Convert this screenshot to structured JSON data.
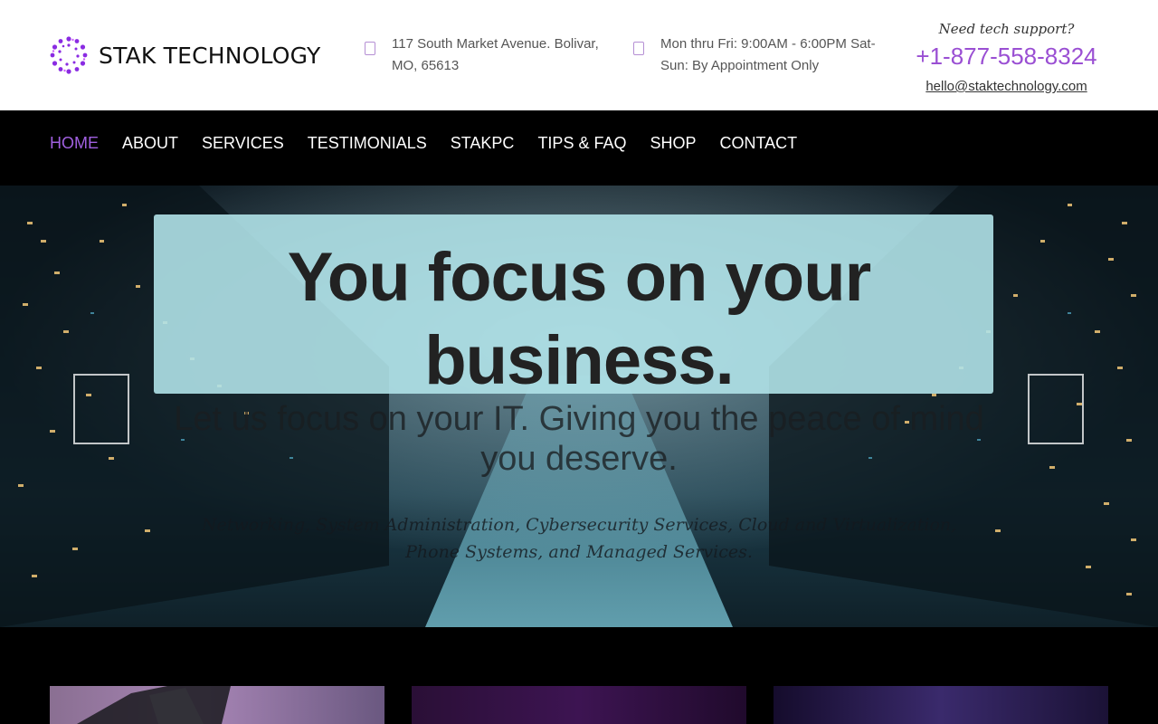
{
  "brand": {
    "name": "STAK TECHNOLOGY",
    "accent": "#9a4fd3"
  },
  "header": {
    "address": "117 South Market Avenue. Bolivar, MO, 65613",
    "hours": "Mon thru Fri: 9:00AM - 6:00PM Sat-Sun: By Appointment Only",
    "support_label": "Need tech support?",
    "phone": "+1-877-558-8324",
    "email": "hello@staktechnology.com",
    "icons": [
      "map-pin-icon",
      "clock-icon",
      "logo-dots-icon"
    ]
  },
  "nav": {
    "items": [
      {
        "label": "HOME",
        "active": true
      },
      {
        "label": "ABOUT"
      },
      {
        "label": "SERVICES"
      },
      {
        "label": "TESTIMONIALS"
      },
      {
        "label": "STAKPC"
      },
      {
        "label": "TIPS & FAQ"
      },
      {
        "label": "SHOP"
      },
      {
        "label": "CONTACT"
      }
    ],
    "active_color": "#a060e0"
  },
  "hero": {
    "title": "You focus on your business.",
    "subtitle": "Let us focus on your IT. Giving you the peace of mind you deserve.",
    "services": "Networking, System Administration, Cybersecurity Services, Cloud and Virtualization, Phone Systems, and Managed Services.",
    "icons": [
      "prev-arrow-icon",
      "next-arrow-icon"
    ]
  }
}
